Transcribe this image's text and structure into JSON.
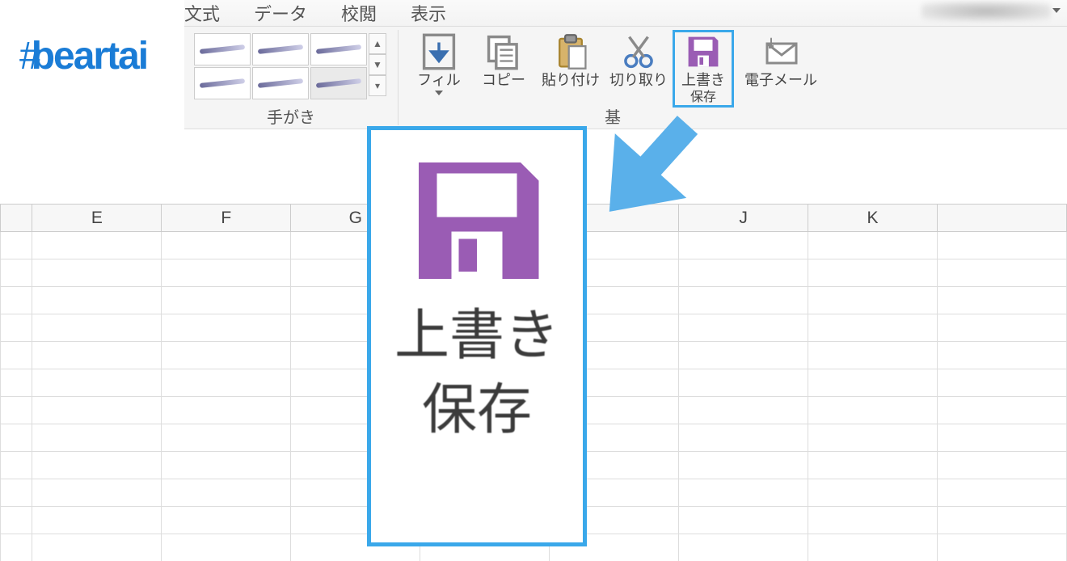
{
  "logo": {
    "text": "beartai"
  },
  "menu": {
    "items": [
      "文式",
      "データ",
      "校閲",
      "表示"
    ]
  },
  "ribbon": {
    "groups": {
      "handwriting_label": "手がき",
      "basic_label": "基"
    },
    "buttons": {
      "fill": {
        "label": "フィル"
      },
      "copy": {
        "label": "コピー"
      },
      "paste": {
        "label": "貼り付け"
      },
      "cut": {
        "label": "切り取り"
      },
      "save": {
        "label1": "上書き",
        "label2": "保存"
      },
      "mail": {
        "label": "電子メール"
      }
    }
  },
  "callout": {
    "line1": "上書き",
    "line2": "保存"
  },
  "sheet": {
    "columns": [
      "E",
      "F",
      "G",
      "",
      "",
      "J",
      "K"
    ],
    "row_count": 12
  },
  "colors": {
    "highlight": "#3aa8ea",
    "save_icon": "#9a5cb4"
  }
}
